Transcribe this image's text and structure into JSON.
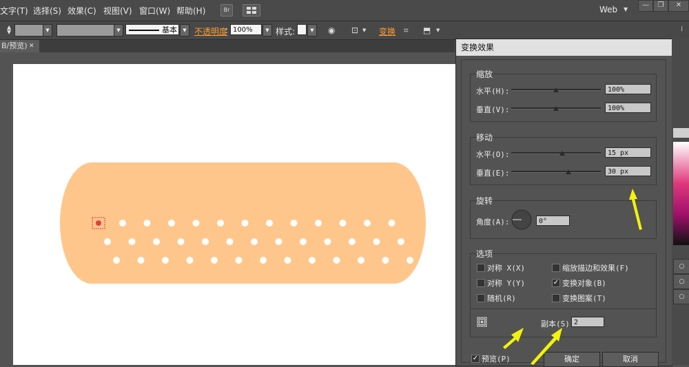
{
  "menubar": {
    "items": [
      "文字(T)",
      "选择(S)",
      "效果(C)",
      "视图(V)",
      "窗口(W)",
      "帮助(H)"
    ],
    "bridge_label": "Br",
    "workspace": "Web",
    "win_buttons": [
      "—",
      "❐",
      "✕"
    ]
  },
  "controlbar": {
    "stroke_profile": "基本",
    "opacity_label": "不透明度",
    "opacity_value": "100%",
    "style_label": "样式:",
    "transform_label": "变换"
  },
  "document_tab": {
    "label": "B/预览)",
    "close": "✕"
  },
  "dialog": {
    "title": "变换效果",
    "scale": {
      "title": "缩放",
      "h_label": "水平(H):",
      "h_value": "100%",
      "h_level": 0.5,
      "v_label": "垂直(V):",
      "v_value": "100%",
      "v_level": 0.5
    },
    "move": {
      "title": "移动",
      "h_label": "水平(O):",
      "h_value": "15 px",
      "v_label": "垂直(E):",
      "v_value": "30 px"
    },
    "rotate": {
      "title": "旋转",
      "angle_label": "角度(A):",
      "angle_value": "0°"
    },
    "options": {
      "title": "选项",
      "reflect_x": "对称 X(X)",
      "reflect_y": "对称 Y(Y)",
      "random": "随机(R)",
      "scale_strokes": "缩放描边和效果(F)",
      "transform_objects": "变换对象(B)",
      "transform_patterns": "变换图案(T)",
      "copies_label": "副本(S)",
      "copies_value": "2"
    },
    "preview_label": "预览(P)",
    "ok_label": "确定",
    "cancel_label": "取消",
    "checkmark": "✓"
  },
  "colors": {
    "bandage": "#ffc68c",
    "annotation_arrow": "#f2f20b",
    "accent_link": "#ff9d2d"
  }
}
